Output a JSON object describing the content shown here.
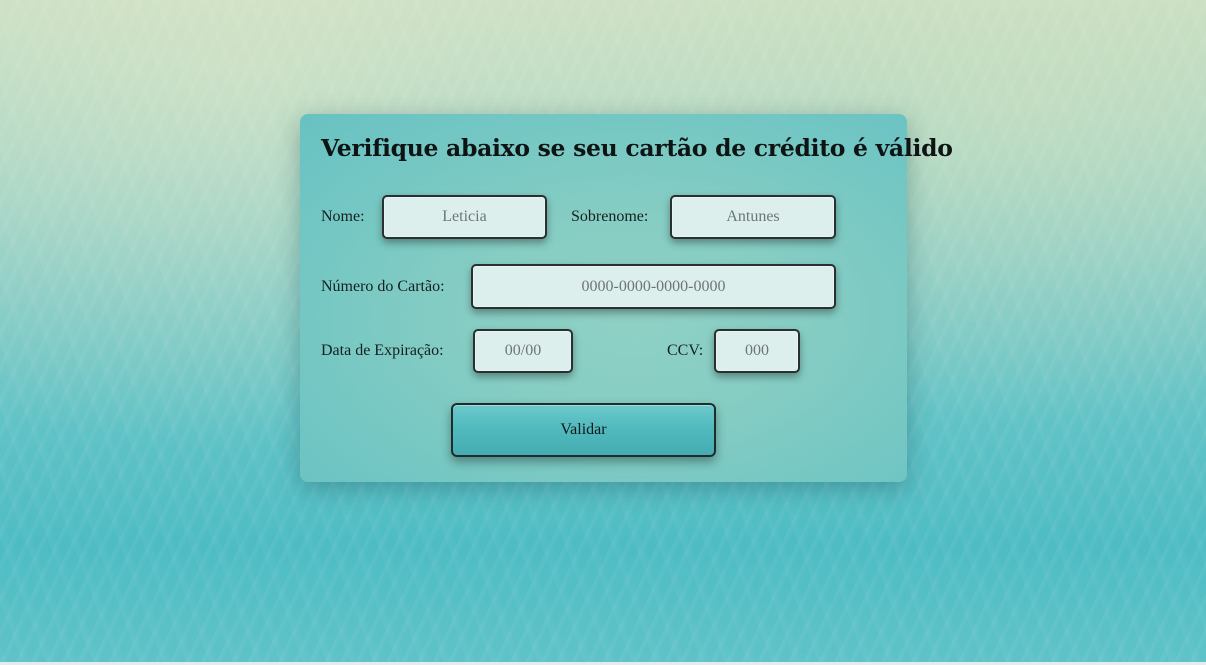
{
  "form": {
    "title": "Verifique abaixo se seu cartão de crédito é válido",
    "fields": {
      "nome": {
        "label": "Nome:",
        "placeholder": "Leticia"
      },
      "sobrenome": {
        "label": "Sobrenome:",
        "placeholder": "Antunes"
      },
      "numero": {
        "label": "Número do Cartão:",
        "placeholder": "0000-0000-0000-0000"
      },
      "expiracao": {
        "label": "Data de Expiração:",
        "placeholder": "00/00"
      },
      "ccv": {
        "label": "CCV:",
        "placeholder": "000"
      }
    },
    "submit_label": "Validar"
  }
}
